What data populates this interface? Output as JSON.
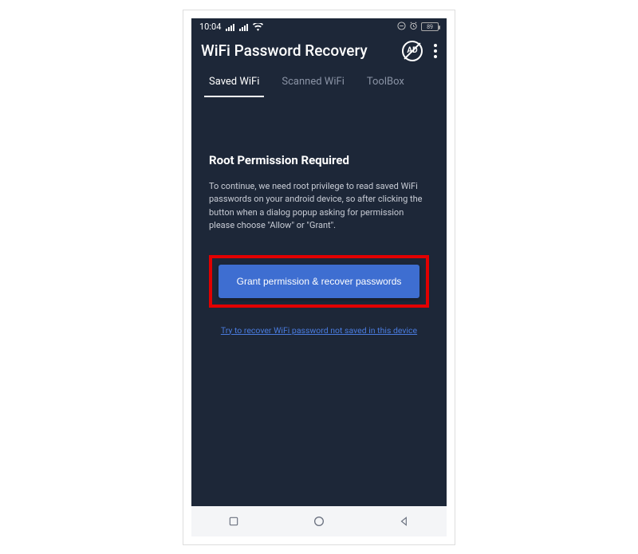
{
  "status_bar": {
    "time": "10:04",
    "battery_level": "89"
  },
  "app_bar": {
    "title": "WiFi Password Recovery",
    "ad_label": "AD"
  },
  "tabs": [
    {
      "label": "Saved WiFi",
      "active": true
    },
    {
      "label": "Scanned WiFi",
      "active": false
    },
    {
      "label": "ToolBox",
      "active": false
    }
  ],
  "content": {
    "heading": "Root Permission Required",
    "body": "To continue, we need root privilege to read saved WiFi passwords on your android device, so after clicking the button when a dialog popup asking for permission please choose \"Allow\" or \"Grant\".",
    "primary_button": "Grant permission & recover passwords",
    "link": "Try to recover WiFi password not saved in this device"
  }
}
